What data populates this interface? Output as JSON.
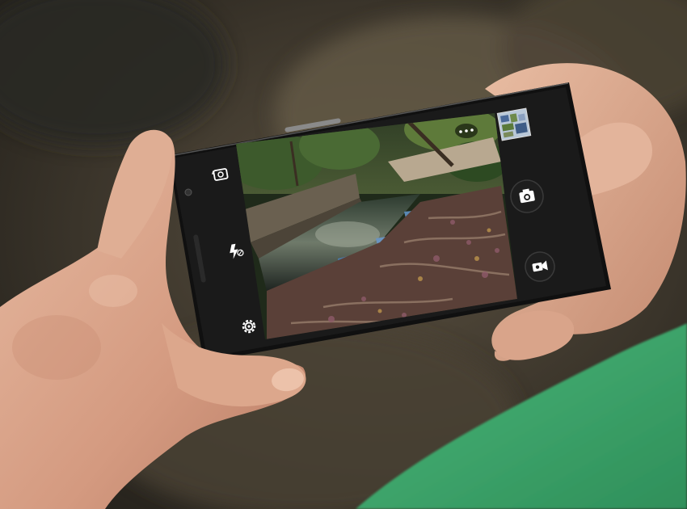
{
  "scene": {
    "description_free": true
  },
  "camera_app": {
    "left_controls": [
      {
        "id": "switch-camera",
        "icon": "switch-camera-icon"
      },
      {
        "id": "flash",
        "icon": "flash-off-icon"
      },
      {
        "id": "settings",
        "icon": "settings-gear-icon"
      }
    ],
    "right_controls": [
      {
        "id": "more",
        "icon": "more-dots-icon"
      },
      {
        "id": "gallery",
        "icon": "gallery-thumbnail"
      },
      {
        "id": "shutter",
        "icon": "camera-shutter-icon"
      },
      {
        "id": "video",
        "icon": "video-camera-icon"
      }
    ]
  },
  "colors": {
    "background_dark": "#2a2620",
    "skin": "#d9a88e",
    "shirt_green": "#3fa86e",
    "phone_body": "#141414",
    "icon_white": "#ffffff"
  }
}
